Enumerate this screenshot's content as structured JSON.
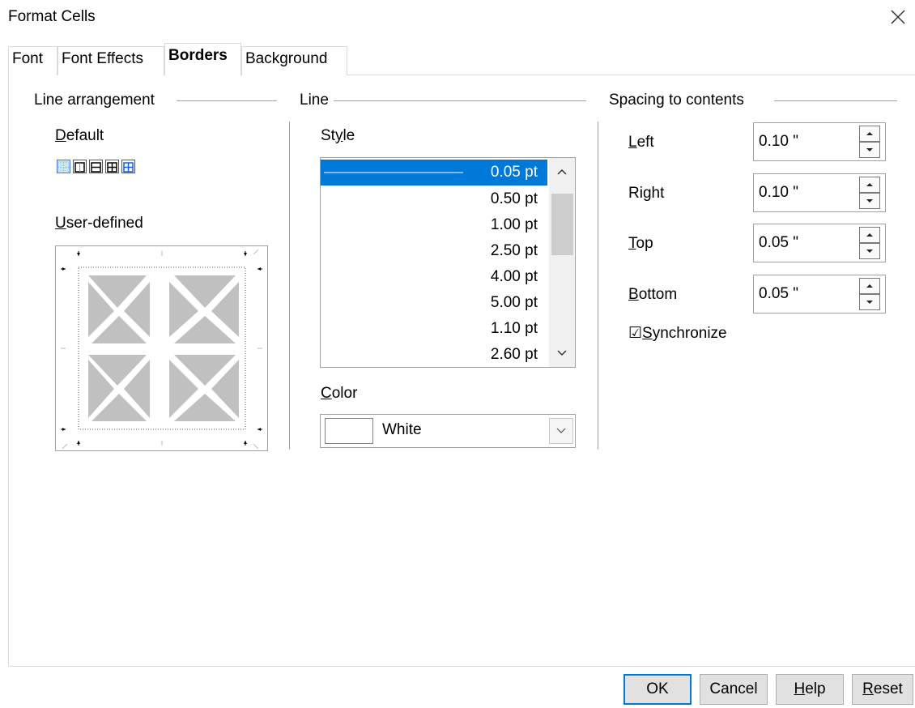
{
  "window": {
    "title": "Format Cells"
  },
  "tabs": [
    {
      "label": "Font"
    },
    {
      "label": "Font Effects"
    },
    {
      "label": "Borders"
    },
    {
      "label": "Background"
    }
  ],
  "line_arrangement": {
    "title": "Line arrangement",
    "default_label_u": "D",
    "default_label_rest": "efault",
    "user_defined_u": "U",
    "user_defined_rest": "ser-defined",
    "presets": [
      "no-borders-icon",
      "outer-border-only-icon",
      "outer-border-horizontal-icon",
      "outer-border-all-inner-icon",
      "outer-border-no-inner-icon"
    ]
  },
  "line": {
    "title": "Line",
    "style_label_pre": "St",
    "style_label_u": "y",
    "style_label_post": "le",
    "styles": [
      "0.05 pt",
      "0.50 pt",
      "1.00 pt",
      "2.50 pt",
      "4.00 pt",
      "5.00 pt",
      "1.10 pt",
      "2.60 pt"
    ],
    "selected_style": "0.05 pt",
    "color_label_u": "C",
    "color_label_rest": "olor",
    "color_value": "White",
    "swatch_color": "#ffffff"
  },
  "spacing": {
    "title": "Spacing to contents",
    "fields": [
      {
        "label_pre": "",
        "label_u": "L",
        "label_post": "eft",
        "value": "0.10 \""
      },
      {
        "label_pre": "Ri",
        "label_u": "g",
        "label_post": "ht",
        "value": "0.10 \""
      },
      {
        "label_pre": "",
        "label_u": "T",
        "label_post": "op",
        "value": "0.05 \""
      },
      {
        "label_pre": "",
        "label_u": "B",
        "label_post": "ottom",
        "value": "0.05 \""
      }
    ],
    "sync_checked": "☑",
    "sync_label_u": "S",
    "sync_label_rest": "ynchronize"
  },
  "buttons": {
    "ok": "OK",
    "cancel": "Cancel",
    "help_u": "H",
    "help_rest": "elp",
    "reset_u": "R",
    "reset_rest": "eset"
  },
  "colors": {
    "accent": "#0078d7",
    "selection": "#0078d7",
    "preview_fill": "#c0c0c0"
  }
}
